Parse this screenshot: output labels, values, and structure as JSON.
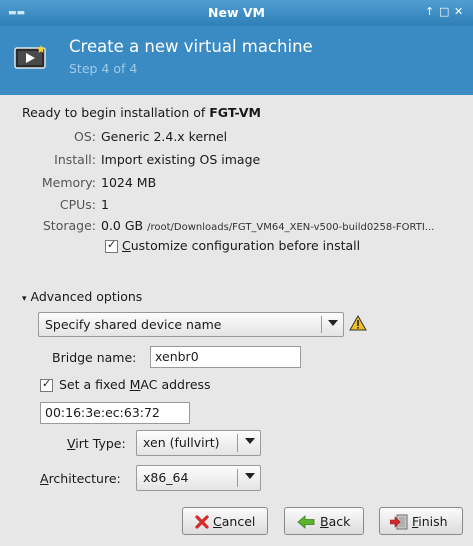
{
  "window": {
    "title": "New VM",
    "controls": [
      "↑",
      "□",
      "✕"
    ]
  },
  "header": {
    "title": "Create a new virtual machine",
    "step": "Step 4 of 4"
  },
  "summary": {
    "ready_prefix": "Ready to begin installation of",
    "vm_name": "FGT-VM",
    "rows": [
      {
        "label": "OS:",
        "value": "Generic 2.4.x kernel"
      },
      {
        "label": "Install:",
        "value": "Import existing OS image"
      },
      {
        "label": "Memory:",
        "value": "1024 MB"
      },
      {
        "label": "CPUs:",
        "value": "1"
      }
    ],
    "storage": {
      "label": "Storage:",
      "size": "0.0 GB",
      "path": "/root/Downloads/FGT_VM64_XEN-v500-build0258-FORTI..."
    },
    "customize": {
      "label_pre": "",
      "label_ul": "C",
      "label_post": "ustomize configuration before install",
      "checked": true
    }
  },
  "advanced": {
    "expander_label": "Advanced options",
    "device_select": "Specify shared device name",
    "bridge_label": "Bridge name:",
    "bridge_value": "xenbr0",
    "mac": {
      "label_pre": "Set a fixed ",
      "label_ul": "M",
      "label_post": "AC address",
      "checked": true
    },
    "mac_value": "00:16:3e:ec:63:72",
    "virt_type": {
      "label_pre": "",
      "label_ul": "V",
      "label_post": "irt Type:",
      "value": "xen (fullvirt)"
    },
    "architecture": {
      "label_pre": "",
      "label_ul": "A",
      "label_post": "rchitecture:",
      "value": "x86_64"
    }
  },
  "buttons": {
    "cancel": {
      "ul": "C",
      "rest": "ancel"
    },
    "back": {
      "ul": "B",
      "rest": "ack"
    },
    "finish": {
      "ul": "F",
      "rest": "inish"
    }
  },
  "colors": {
    "titlebar": "#3a8bc4",
    "header_sub": "#9fcbe9",
    "warning": "#f0c020"
  },
  "icons": [
    "window-menu-icon",
    "vm-monitor-icon",
    "warning-icon",
    "cancel-icon",
    "back-arrow-icon",
    "finish-icon"
  ]
}
